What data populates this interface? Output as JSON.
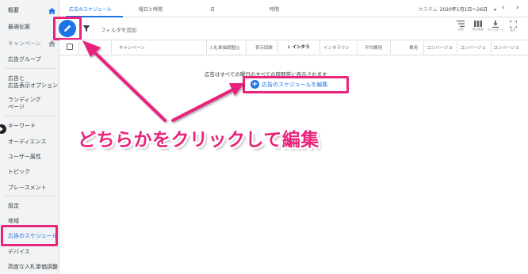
{
  "sidebar": {
    "items": [
      {
        "label": "概要"
      },
      {
        "label": "最適化案"
      },
      {
        "label": "キャンペーン"
      },
      {
        "label": "広告グループ"
      },
      {
        "label": "広告と"
      },
      {
        "label": "広告表示オプション"
      },
      {
        "label": "ランディング"
      },
      {
        "label": "ページ"
      },
      {
        "label": "キーワード"
      },
      {
        "label": "オーディエンス"
      },
      {
        "label": "ユーザー属性"
      },
      {
        "label": "トピック"
      },
      {
        "label": "プレースメント"
      },
      {
        "label": "設定"
      },
      {
        "label": "地域"
      },
      {
        "label": "広告のスケジュール"
      },
      {
        "label": "デバイス"
      },
      {
        "label": "高度な入札単価調整"
      }
    ]
  },
  "tabs": [
    {
      "label": "広告のスケジュール"
    },
    {
      "label": "曜日と時間"
    },
    {
      "label": "日"
    },
    {
      "label": "時間"
    }
  ],
  "daterange": {
    "label": "カスタム",
    "value": "2020年1月1日〜26日"
  },
  "filterbar": {
    "add_filter": "フィルタを追加",
    "tools": [
      {
        "label": "分割"
      },
      {
        "label": "表示項目"
      },
      {
        "label": "ダウンロード"
      },
      {
        "label": "拡大"
      }
    ]
  },
  "table": {
    "headers": [
      "キャンペーン",
      "入札単価調整比",
      "表示回数",
      "インタラ",
      "インタラクシ",
      "平均費用",
      "費用",
      "コンバージョ",
      "コンバージョ",
      "コンバージョ"
    ]
  },
  "empty": {
    "message": "広告はすべての曜日のすべての時間帯に表示されます",
    "link": "広告のスケジュールを編集"
  },
  "annotation": {
    "text": "どちらかをクリックして編集",
    "color": "#e8247c"
  },
  "colors": {
    "accent": "#1a73e8",
    "highlight": "#e8247c"
  }
}
